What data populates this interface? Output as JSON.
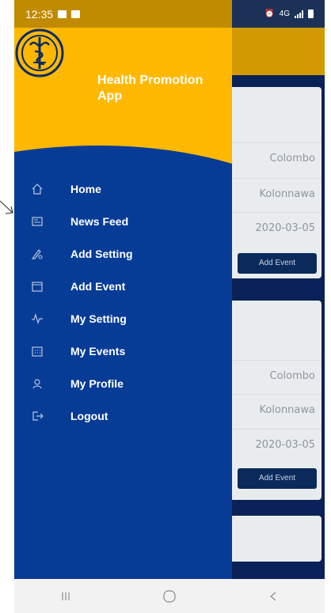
{
  "status_bar": {
    "time": "12:35",
    "network": "4G"
  },
  "drawer": {
    "app_title": "Health Promotion App",
    "menu": [
      {
        "label": "Home",
        "icon": "home-icon"
      },
      {
        "label": "News Feed",
        "icon": "news-icon"
      },
      {
        "label": "Add Setting",
        "icon": "add-setting-icon"
      },
      {
        "label": "Add Event",
        "icon": "calendar-icon"
      },
      {
        "label": "My Setting",
        "icon": "pulse-icon"
      },
      {
        "label": "My Events",
        "icon": "events-icon"
      },
      {
        "label": "My Profile",
        "icon": "user-icon"
      },
      {
        "label": "Logout",
        "icon": "logout-icon"
      }
    ]
  },
  "background": {
    "cards": [
      {
        "city": "Colombo",
        "area": "Kolonnawa",
        "date": "2020-03-05",
        "button": "Add Event"
      },
      {
        "city": "Colombo",
        "area": "Kolonnawa",
        "date": "2020-03-05",
        "button": "Add Event"
      }
    ]
  },
  "colors": {
    "header_yellow": "#ffb800",
    "drawer_blue": "#073c96",
    "menu_icon": "#b9c6e0"
  }
}
